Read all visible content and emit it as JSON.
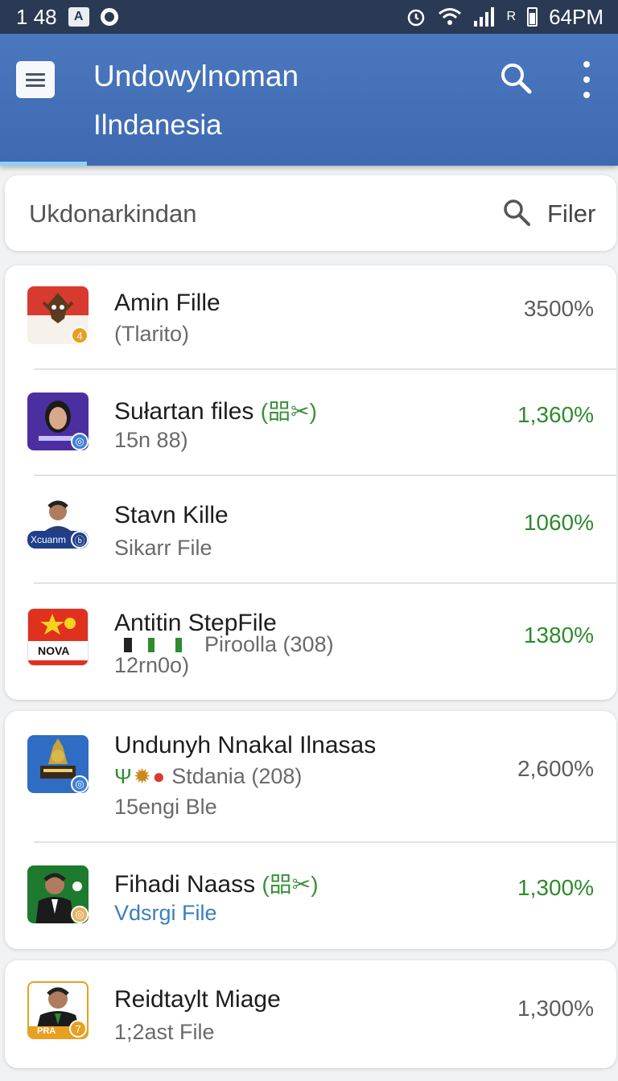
{
  "status_bar": {
    "time": "1 48",
    "app_icon_glyph": "A",
    "right_time": "64PM",
    "net_label": "R"
  },
  "app_bar": {
    "title": "Undowylnoman",
    "subtitle": "Ilndanesia"
  },
  "search": {
    "text": "Ukdonarkindan",
    "filter_label": "Filer"
  },
  "cards": [
    {
      "rows": [
        {
          "title": "Amin Fille",
          "subtitle": "(Tlarito)",
          "value": "3500%",
          "value_color": "grey",
          "badge": "4",
          "avatar": "flag"
        },
        {
          "title": "Sułartan files",
          "tag": "(㗊✂)",
          "subtitle": "15n 88)",
          "value": "1,360%",
          "value_color": "green",
          "badge": "◎",
          "avatar": "portrait-purple"
        },
        {
          "title": "Stavn Kille",
          "subtitle": "Sikarr File",
          "value": "1060%",
          "value_color": "green",
          "badge": "ⓑ",
          "avatar": "portrait-white",
          "label": "Xcuanm"
        },
        {
          "title": "Antitin StepFile",
          "subtitle2": "Piroolla (308)",
          "subtitle": "12rn0o)",
          "value": "1380%",
          "value_color": "green",
          "avatar": "nova",
          "label": "NOVA"
        }
      ]
    },
    {
      "rows": [
        {
          "title": "Undunyh Nnakal Ilnasas",
          "subtitle2": "Stdania (208)",
          "subtitle": "15engi Ble",
          "value": "2,600%",
          "value_color": "grey",
          "badge": "◎",
          "avatar": "temple"
        },
        {
          "title": "Fihadi Naass",
          "tag": "(㗊✂)",
          "subtitle": "Vdsrgi File",
          "value": "1,300%",
          "value_color": "green",
          "badge": "◎",
          "avatar": "portrait-green"
        }
      ]
    },
    {
      "rows": [
        {
          "title": "Reidtaylt Miage",
          "subtitle": "1;2ast File",
          "value": "1,300%",
          "value_color": "grey",
          "badge": "7",
          "avatar": "portrait-gold",
          "label": "PRA"
        }
      ]
    }
  ],
  "colors": {
    "status_bar": "#2a3a55",
    "app_bar": "#4a77be",
    "green_value": "#2e8b2e",
    "grey_value": "#5d5d5d"
  },
  "icons": [
    "menu-icon",
    "search-icon",
    "more-vert-icon",
    "filter-search-icon",
    "alarm-icon",
    "wifi-icon",
    "signal-icon",
    "battery-icon"
  ]
}
